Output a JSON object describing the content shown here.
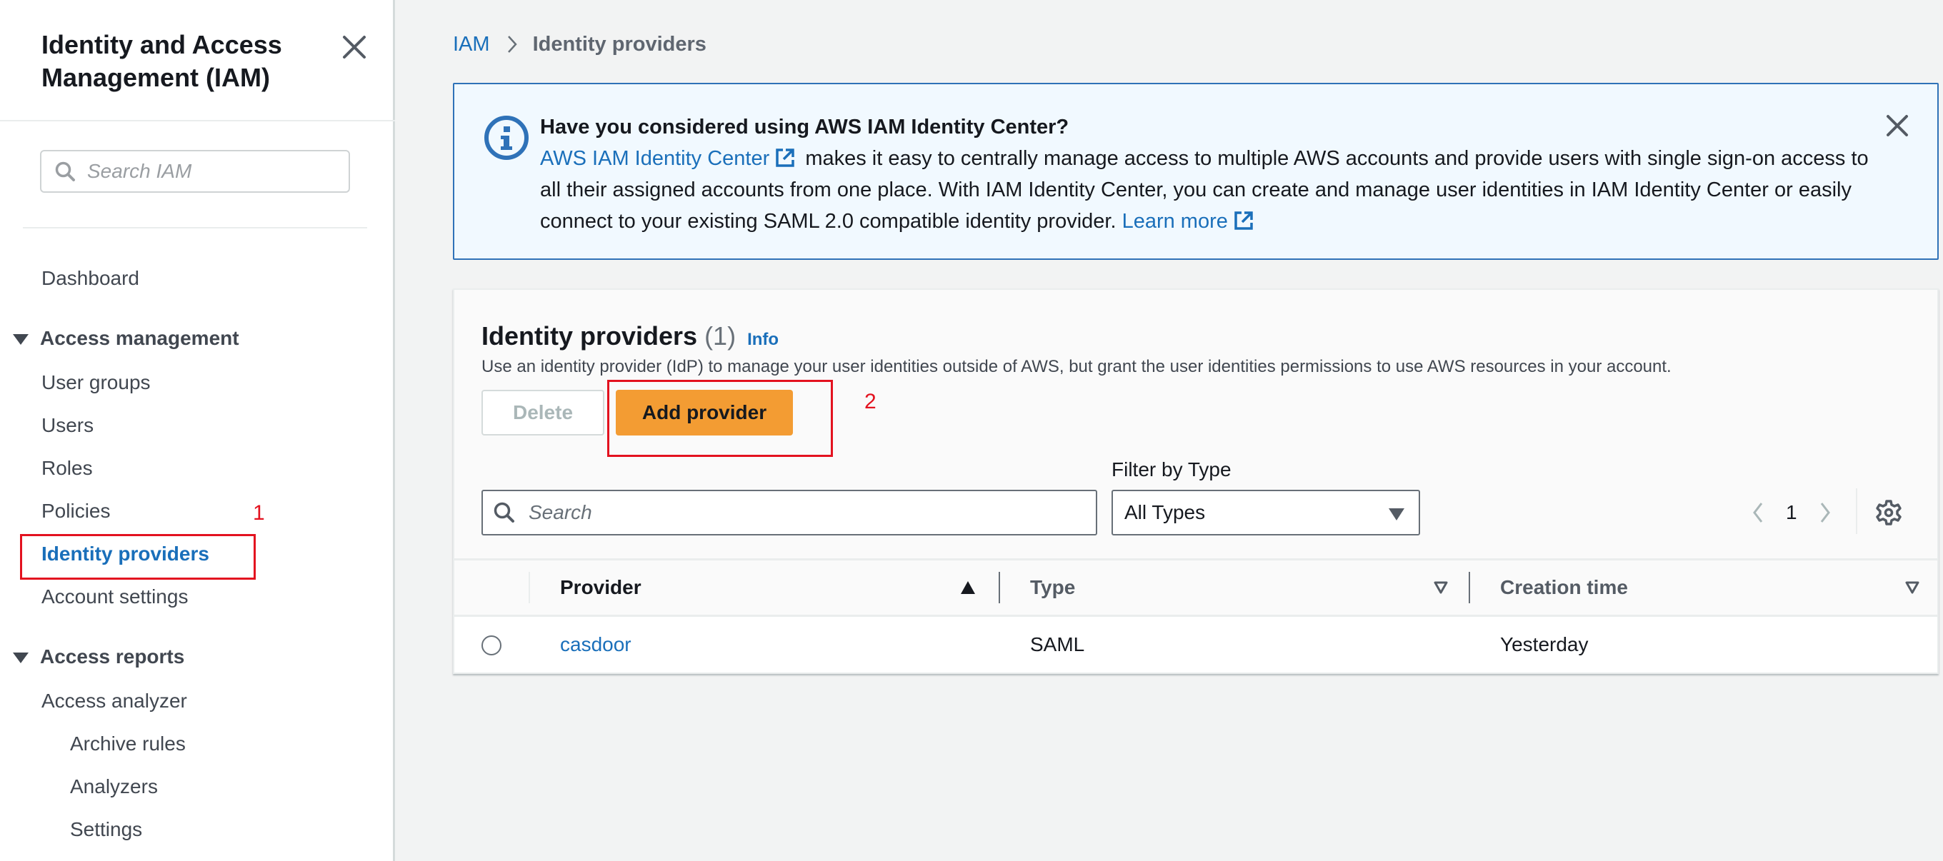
{
  "sidebar": {
    "title": "Identity and Access Management (IAM)",
    "search_placeholder": "Search IAM",
    "dashboard": "Dashboard",
    "sections": [
      {
        "label": "Access management",
        "items": [
          "User groups",
          "Users",
          "Roles",
          "Policies",
          "Identity providers",
          "Account settings"
        ]
      },
      {
        "label": "Access reports",
        "items": [
          "Access analyzer",
          "Archive rules",
          "Analyzers",
          "Settings"
        ]
      }
    ],
    "active_item": "Identity providers"
  },
  "annotations": {
    "step1": "1",
    "step2": "2",
    "color": "#e3121f"
  },
  "breadcrumb": {
    "root": "IAM",
    "current": "Identity providers"
  },
  "flash": {
    "title": "Have you considered using AWS IAM Identity Center?",
    "link_text": "AWS IAM Identity Center",
    "body": "makes it easy to centrally manage access to multiple AWS accounts and provide users with single sign-on access to all their assigned accounts from one place. With IAM Identity Center, you can create and manage user identities in IAM Identity Center or easily connect to your existing SAML 2.0 compatible identity provider.",
    "learn_more": "Learn more"
  },
  "panel": {
    "title": "Identity providers",
    "count": "(1)",
    "info": "Info",
    "description": "Use an identity provider (IdP) to manage your user identities outside of AWS, but grant the user identities permissions to use AWS resources in your account.",
    "delete_label": "Delete",
    "add_label": "Add provider",
    "filter_label": "Filter by Type",
    "search_placeholder": "Search",
    "filter_value": "All Types",
    "page": "1",
    "columns": [
      "Provider",
      "Type",
      "Creation time"
    ],
    "rows": [
      {
        "provider": "casdoor",
        "type": "SAML",
        "creation_time": "Yesterday"
      }
    ]
  },
  "colors": {
    "link": "#1a6fba",
    "primary_button": "#f39c33",
    "info_border": "#2f72b8",
    "info_bg": "#f1f9ff"
  }
}
